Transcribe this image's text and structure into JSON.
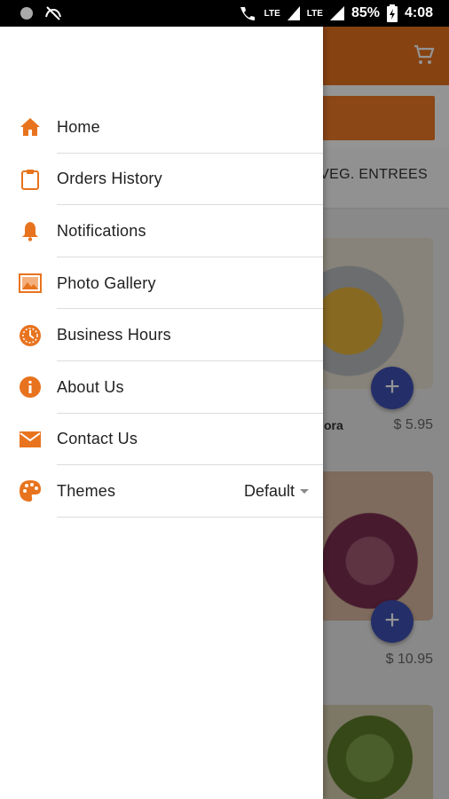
{
  "status_bar": {
    "battery": "85%",
    "time": "4:08",
    "network_1": "LTE",
    "network_2": "LTE"
  },
  "colors": {
    "accent": "#e8731e",
    "fab": "#3f51b5"
  },
  "background_app": {
    "tab_label": "VEG. ENTREES",
    "item_name_fragment": "ora",
    "prices": [
      "$ 5.95",
      "$ 10.95"
    ],
    "add_button_glyph": "+"
  },
  "drawer": {
    "items": [
      {
        "label": "Home",
        "icon": "home-icon"
      },
      {
        "label": "Orders History",
        "icon": "clipboard-icon"
      },
      {
        "label": "Notifications",
        "icon": "bell-icon"
      },
      {
        "label": "Photo Gallery",
        "icon": "photo-icon"
      },
      {
        "label": "Business Hours",
        "icon": "clock-icon"
      },
      {
        "label": "About Us",
        "icon": "info-icon"
      },
      {
        "label": "Contact Us",
        "icon": "mail-icon"
      },
      {
        "label": "Themes",
        "icon": "palette-icon",
        "value": "Default"
      }
    ]
  }
}
